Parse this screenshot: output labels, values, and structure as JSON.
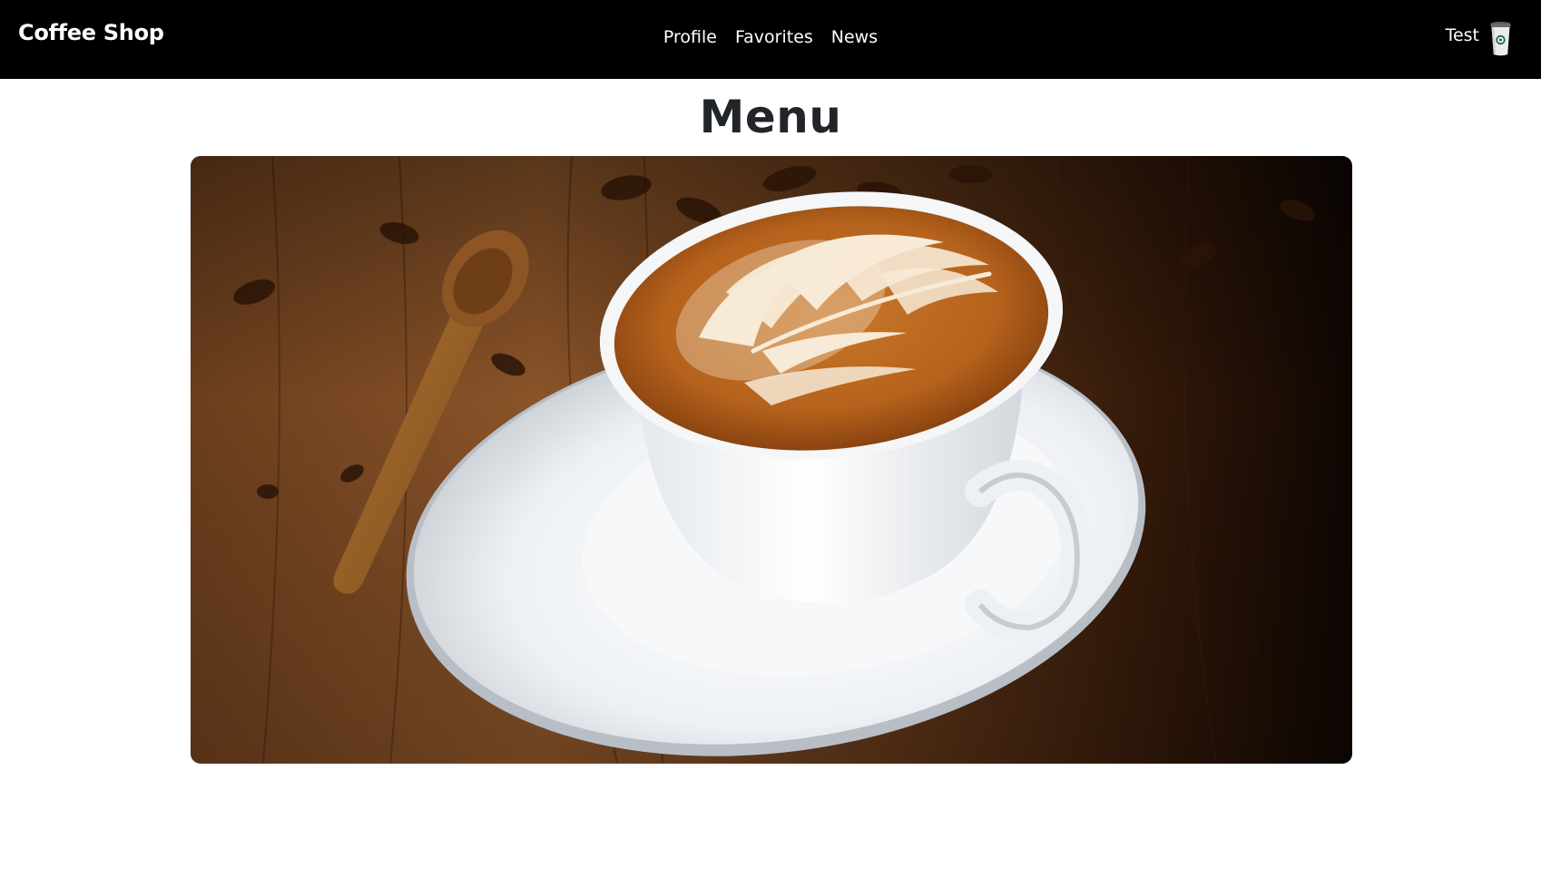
{
  "navbar": {
    "brand": "Coffee Shop",
    "links": [
      {
        "label": "Profile"
      },
      {
        "label": "Favorites"
      },
      {
        "label": "News"
      }
    ],
    "user": {
      "name": "Test",
      "icon": "coffee-cup-icon"
    }
  },
  "main": {
    "title": "Menu",
    "hero_image": {
      "subject": "latte-art-coffee-cup"
    }
  },
  "colors": {
    "navbar_bg": "#000000",
    "nav_text": "#ffffff",
    "title_text": "#212529",
    "cup_green": "#1e6b52"
  }
}
